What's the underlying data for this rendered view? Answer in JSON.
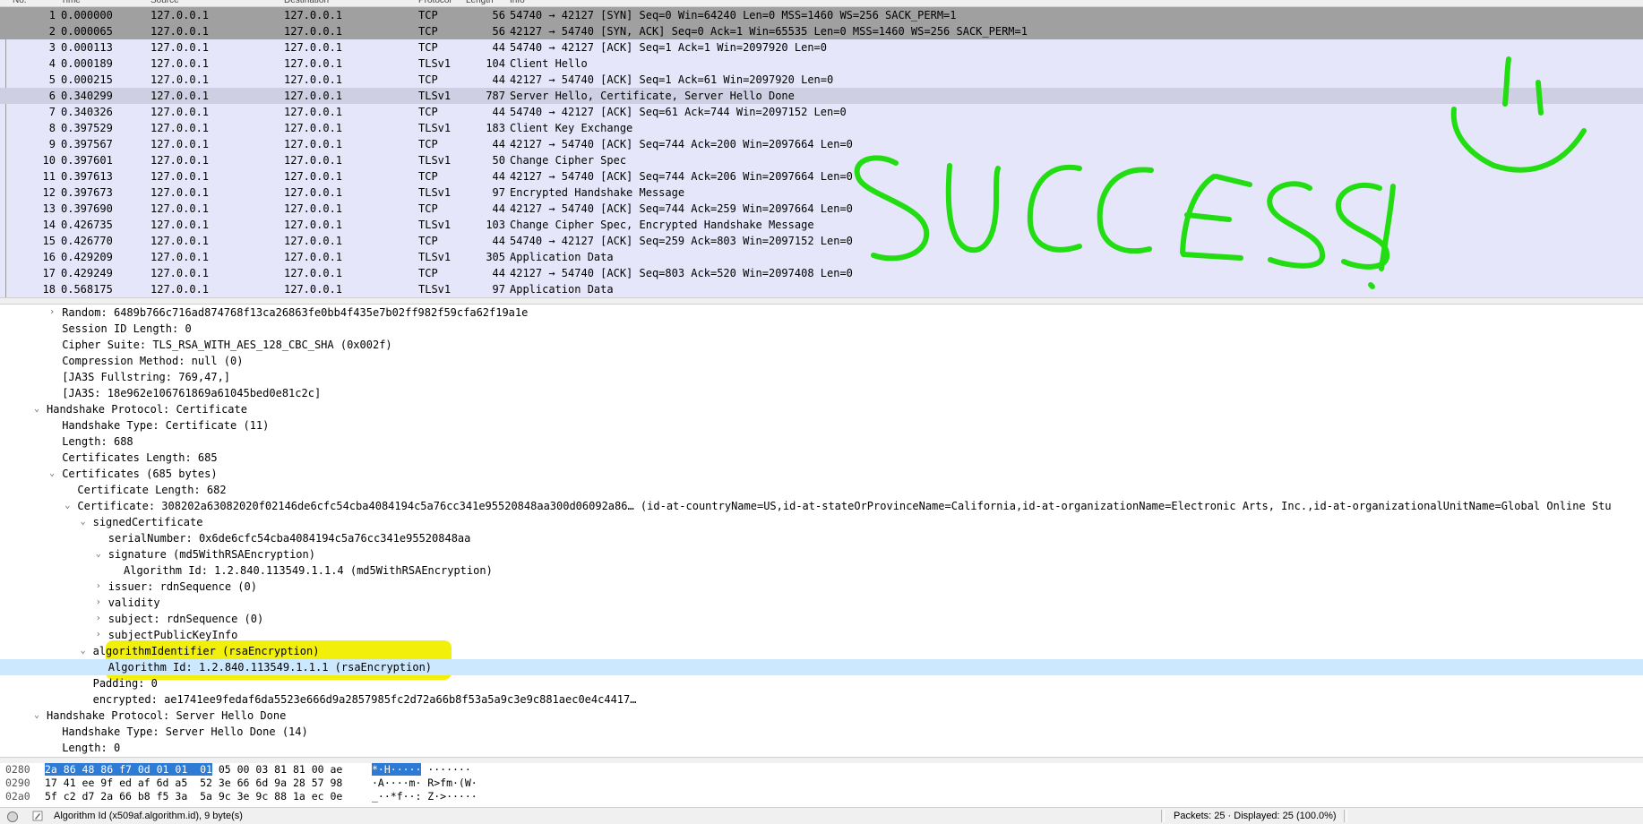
{
  "packet_list": {
    "columns": [
      "No.",
      "Time",
      "Source",
      "Destination",
      "Protocol",
      "Length",
      "Info"
    ],
    "rows": [
      {
        "no": "1",
        "time": "0.000000",
        "src": "127.0.0.1",
        "dst": "127.0.0.1",
        "proto": "TCP",
        "len": "56",
        "info": "54740 → 42127 [SYN] Seq=0 Win=64240 Len=0 MSS=1460 WS=256 SACK_PERM=1",
        "style": "selected-dark"
      },
      {
        "no": "2",
        "time": "0.000065",
        "src": "127.0.0.1",
        "dst": "127.0.0.1",
        "proto": "TCP",
        "len": "56",
        "info": "42127 → 54740 [SYN, ACK] Seq=0 Ack=1 Win=65535 Len=0 MSS=1460 WS=256 SACK_PERM=1",
        "style": "selected-dark"
      },
      {
        "no": "3",
        "time": "0.000113",
        "src": "127.0.0.1",
        "dst": "127.0.0.1",
        "proto": "TCP",
        "len": "44",
        "info": "54740 → 42127 [ACK] Seq=1 Ack=1 Win=2097920 Len=0",
        "style": ""
      },
      {
        "no": "4",
        "time": "0.000189",
        "src": "127.0.0.1",
        "dst": "127.0.0.1",
        "proto": "TLSv1",
        "len": "104",
        "info": "Client Hello",
        "style": ""
      },
      {
        "no": "5",
        "time": "0.000215",
        "src": "127.0.0.1",
        "dst": "127.0.0.1",
        "proto": "TCP",
        "len": "44",
        "info": "42127 → 54740 [ACK] Seq=1 Ack=61 Win=2097920 Len=0",
        "style": ""
      },
      {
        "no": "6",
        "time": "0.340299",
        "src": "127.0.0.1",
        "dst": "127.0.0.1",
        "proto": "TLSv1",
        "len": "787",
        "info": "Server Hello, Certificate, Server Hello Done",
        "style": "selected-light"
      },
      {
        "no": "7",
        "time": "0.340326",
        "src": "127.0.0.1",
        "dst": "127.0.0.1",
        "proto": "TCP",
        "len": "44",
        "info": "54740 → 42127 [ACK] Seq=61 Ack=744 Win=2097152 Len=0",
        "style": ""
      },
      {
        "no": "8",
        "time": "0.397529",
        "src": "127.0.0.1",
        "dst": "127.0.0.1",
        "proto": "TLSv1",
        "len": "183",
        "info": "Client Key Exchange",
        "style": ""
      },
      {
        "no": "9",
        "time": "0.397567",
        "src": "127.0.0.1",
        "dst": "127.0.0.1",
        "proto": "TCP",
        "len": "44",
        "info": "42127 → 54740 [ACK] Seq=744 Ack=200 Win=2097664 Len=0",
        "style": ""
      },
      {
        "no": "10",
        "time": "0.397601",
        "src": "127.0.0.1",
        "dst": "127.0.0.1",
        "proto": "TLSv1",
        "len": "50",
        "info": "Change Cipher Spec",
        "style": ""
      },
      {
        "no": "11",
        "time": "0.397613",
        "src": "127.0.0.1",
        "dst": "127.0.0.1",
        "proto": "TCP",
        "len": "44",
        "info": "42127 → 54740 [ACK] Seq=744 Ack=206 Win=2097664 Len=0",
        "style": ""
      },
      {
        "no": "12",
        "time": "0.397673",
        "src": "127.0.0.1",
        "dst": "127.0.0.1",
        "proto": "TLSv1",
        "len": "97",
        "info": "Encrypted Handshake Message",
        "style": ""
      },
      {
        "no": "13",
        "time": "0.397690",
        "src": "127.0.0.1",
        "dst": "127.0.0.1",
        "proto": "TCP",
        "len": "44",
        "info": "42127 → 54740 [ACK] Seq=744 Ack=259 Win=2097664 Len=0",
        "style": ""
      },
      {
        "no": "14",
        "time": "0.426735",
        "src": "127.0.0.1",
        "dst": "127.0.0.1",
        "proto": "TLSv1",
        "len": "103",
        "info": "Change Cipher Spec, Encrypted Handshake Message",
        "style": ""
      },
      {
        "no": "15",
        "time": "0.426770",
        "src": "127.0.0.1",
        "dst": "127.0.0.1",
        "proto": "TCP",
        "len": "44",
        "info": "54740 → 42127 [ACK] Seq=259 Ack=803 Win=2097152 Len=0",
        "style": ""
      },
      {
        "no": "16",
        "time": "0.429209",
        "src": "127.0.0.1",
        "dst": "127.0.0.1",
        "proto": "TLSv1",
        "len": "305",
        "info": "Application Data",
        "style": ""
      },
      {
        "no": "17",
        "time": "0.429249",
        "src": "127.0.0.1",
        "dst": "127.0.0.1",
        "proto": "TCP",
        "len": "44",
        "info": "42127 → 54740 [ACK] Seq=803 Ack=520 Win=2097408 Len=0",
        "style": ""
      },
      {
        "no": "18",
        "time": "0.568175",
        "src": "127.0.0.1",
        "dst": "127.0.0.1",
        "proto": "TLSv1",
        "len": "97",
        "info": "Application Data",
        "style": ""
      }
    ]
  },
  "annotation": {
    "text": "SUCCESS!",
    "color": "#22dd11",
    "smiley_icon": "smiley-face-icon"
  },
  "details": {
    "rows": [
      {
        "indent": 4,
        "arrow": "›",
        "text": "Random: 6489b766c716ad874768f13ca26863fe0bb4f435e7b02ff982f59cfa62f19a1e"
      },
      {
        "indent": 4,
        "arrow": "",
        "text": "Session ID Length: 0"
      },
      {
        "indent": 4,
        "arrow": "",
        "text": "Cipher Suite: TLS_RSA_WITH_AES_128_CBC_SHA (0x002f)"
      },
      {
        "indent": 4,
        "arrow": "",
        "text": "Compression Method: null (0)"
      },
      {
        "indent": 4,
        "arrow": "",
        "text": "[JA3S Fullstring: 769,47,]"
      },
      {
        "indent": 4,
        "arrow": "",
        "text": "[JA3S: 18e962e106761869a61045bed0e81c2c]"
      },
      {
        "indent": 3,
        "arrow": "⌄",
        "text": "Handshake Protocol: Certificate"
      },
      {
        "indent": 4,
        "arrow": "",
        "text": "Handshake Type: Certificate (11)"
      },
      {
        "indent": 4,
        "arrow": "",
        "text": "Length: 688"
      },
      {
        "indent": 4,
        "arrow": "",
        "text": "Certificates Length: 685"
      },
      {
        "indent": 4,
        "arrow": "⌄",
        "text": "Certificates (685 bytes)"
      },
      {
        "indent": 5,
        "arrow": "",
        "text": "Certificate Length: 682"
      },
      {
        "indent": 5,
        "arrow": "⌄",
        "text": "Certificate: 308202a63082020f02146de6cfc54cba4084194c5a76cc341e95520848aa300d06092a86… (id-at-countryName=US,id-at-stateOrProvinceName=California,id-at-organizationName=Electronic Arts, Inc.,id-at-organizationalUnitName=Global Online Stu"
      },
      {
        "indent": 6,
        "arrow": "⌄",
        "text": "signedCertificate"
      },
      {
        "indent": 7,
        "arrow": "",
        "text": "serialNumber: 0x6de6cfc54cba4084194c5a76cc341e95520848aa"
      },
      {
        "indent": 7,
        "arrow": "⌄",
        "text": "signature (md5WithRSAEncryption)"
      },
      {
        "indent": 8,
        "arrow": "",
        "text": "Algorithm Id: 1.2.840.113549.1.1.4 (md5WithRSAEncryption)"
      },
      {
        "indent": 7,
        "arrow": "›",
        "text": "issuer: rdnSequence (0)"
      },
      {
        "indent": 7,
        "arrow": "›",
        "text": "validity"
      },
      {
        "indent": 7,
        "arrow": "›",
        "text": "subject: rdnSequence (0)"
      },
      {
        "indent": 7,
        "arrow": "›",
        "text": "subjectPublicKeyInfo"
      },
      {
        "indent": 6,
        "arrow": "⌄",
        "text": "algorithmIdentifier (rsaEncryption)"
      },
      {
        "indent": 7,
        "arrow": "",
        "text": "Algorithm Id: 1.2.840.113549.1.1.1 (rsaEncryption)",
        "selected": true
      },
      {
        "indent": 6,
        "arrow": "",
        "text": "Padding: 0"
      },
      {
        "indent": 6,
        "arrow": "",
        "text": "encrypted: ae1741ee9fedaf6da5523e666d9a2857985fc2d72a66b8f53a5a9c3e9c881aec0e4c4417…"
      },
      {
        "indent": 3,
        "arrow": "⌄",
        "text": "Handshake Protocol: Server Hello Done"
      },
      {
        "indent": 4,
        "arrow": "",
        "text": "Handshake Type: Server Hello Done (14)"
      },
      {
        "indent": 4,
        "arrow": "",
        "text": "Length: 0"
      }
    ]
  },
  "bytes": {
    "rows": [
      {
        "offset": "0280",
        "hex_sel": "2a 86 48 86 f7 0d 01 01  01",
        "hex_rest": " 05 00 03 81 81 00 ae",
        "asc_sel": "*·H·····",
        "asc_rest": " ·······"
      },
      {
        "offset": "0290",
        "hex_sel": "",
        "hex_rest": "17 41 ee 9f ed af 6d a5  52 3e 66 6d 9a 28 57 98",
        "asc_sel": "",
        "asc_rest": "·A····m· R>fm·(W·"
      },
      {
        "offset": "02a0",
        "hex_sel": "",
        "hex_rest": "5f c2 d7 2a 66 b8 f5 3a  5a 9c 3e 9c 88 1a ec 0e",
        "asc_sel": "",
        "asc_rest": "_··*f··: Z·>·····"
      }
    ]
  },
  "status": {
    "field": "Algorithm Id (x509af.algorithm.id), 9 byte(s)",
    "packets": "Packets: 25 · Displayed: 25 (100.0%)"
  }
}
